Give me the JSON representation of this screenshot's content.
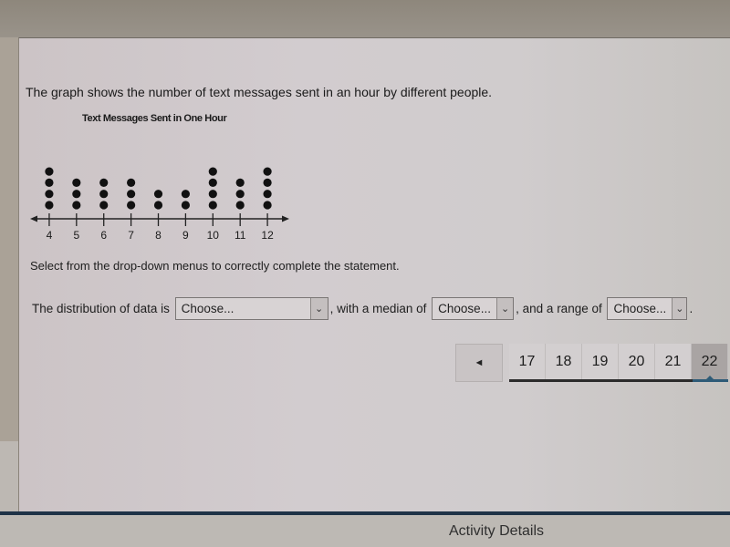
{
  "question": {
    "prompt": "The graph shows the number of text messages sent in an hour by different people.",
    "instruction": "Select from the drop-down menus to correctly complete the statement."
  },
  "chart_data": {
    "type": "scatter",
    "subtype": "dot-plot",
    "title": "Text Messages Sent in One Hour",
    "xlabel": "",
    "ylabel": "",
    "x": [
      4,
      5,
      6,
      7,
      8,
      9,
      10,
      11,
      12
    ],
    "counts": [
      4,
      3,
      3,
      3,
      2,
      2,
      4,
      3,
      4
    ],
    "tick_labels": [
      "4",
      "5",
      "6",
      "7",
      "8",
      "9",
      "10",
      "11",
      "12"
    ],
    "xlim": [
      3.3,
      12.8
    ],
    "grid": false,
    "axis_arrows": "both-ends"
  },
  "statement": {
    "part1": "The distribution of data is ",
    "part2": ", with a median of ",
    "part3": ", and a range of ",
    "part4": ".",
    "dropdowns": [
      {
        "name": "distribution",
        "selected": "Choose..."
      },
      {
        "name": "median",
        "selected": "Choose..."
      },
      {
        "name": "range",
        "selected": "Choose..."
      }
    ]
  },
  "pager": {
    "prev_glyph": "◄",
    "pages": [
      "17",
      "18",
      "19",
      "20",
      "21",
      "22"
    ],
    "current": "22"
  },
  "footer": {
    "title": "Activity Details"
  },
  "icons": {
    "chevron_down": "⌄"
  }
}
